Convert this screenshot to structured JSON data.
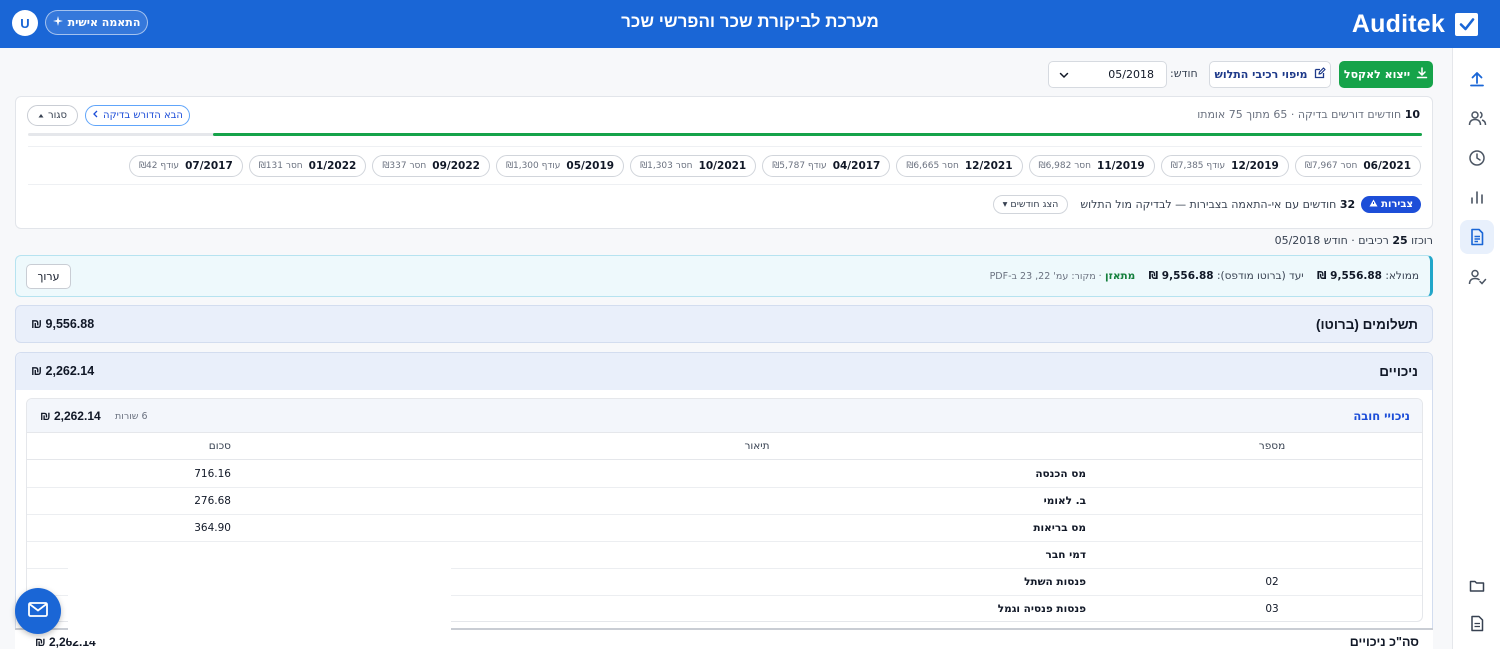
{
  "header": {
    "brand": "Auditek",
    "title": "מערכת לביקורת שכר והפרשי שכר",
    "personal_button": "התאמה אישית",
    "avatar_initial": "U"
  },
  "toolbar": {
    "export_label": "ייצוא לאקסל",
    "map_label": "מיפוי רכיבי התלוש",
    "month_label": "חודש:",
    "month_value": "05/2018"
  },
  "review": {
    "summary_count": "10",
    "summary_text": "חודשים דורשים בדיקה · 65 מתוך 75 אומתו",
    "progress_fraction": 0.867,
    "next_button": "הבא הדורש בדיקה",
    "close_button": "סגור",
    "chips": [
      {
        "month": "06/2021",
        "note": "חסר ₪7,967"
      },
      {
        "month": "12/2019",
        "note": "עודף ₪7,385"
      },
      {
        "month": "11/2019",
        "note": "חסר ₪6,982"
      },
      {
        "month": "12/2021",
        "note": "חסר ₪6,665"
      },
      {
        "month": "04/2017",
        "note": "עודף ₪5,787"
      },
      {
        "month": "10/2021",
        "note": "חסר ₪1,303"
      },
      {
        "month": "05/2019",
        "note": "עודף ₪1,300"
      },
      {
        "month": "09/2022",
        "note": "חסר ₪337"
      },
      {
        "month": "01/2022",
        "note": "חסר ₪131"
      },
      {
        "month": "07/2017",
        "note": "עודף ₪42"
      }
    ],
    "accumulation_badge": "צבירות",
    "accumulation_count": "32",
    "accumulation_text": "חודשים עם אי-התאמה בצבירות — לבדיקה מול התלוש",
    "show_months_button": "הצג חודשים"
  },
  "vehicle_line": {
    "prefix": "רוכזו",
    "count": "25",
    "suffix": "רכיבים · חודש 05/2018"
  },
  "filled": {
    "filled_label": "ממולא:",
    "filled_value": "9,556.88 ₪",
    "target_label": "יעד (ברוטו מודפס):",
    "target_value": "9,556.88 ₪",
    "status": "מתאזן",
    "source": "· מקור: עמ' 22, 23 ב-PDF",
    "edit_button": "ערוך"
  },
  "payments": {
    "title": "תשלומים (ברוטו)",
    "total": "9,556.88 ₪"
  },
  "deductions": {
    "title": "ניכויים",
    "total": "2,262.14 ₪",
    "sub": {
      "title": "ניכויי חובה",
      "total": "2,262.14 ₪",
      "count": "6 שורות",
      "columns": {
        "number": "מספר",
        "description": "תיאור",
        "amount": "סכום"
      },
      "rows": [
        {
          "number": "",
          "description": "מס הכנסה",
          "amount": "716.16"
        },
        {
          "number": "",
          "description": "ב. לאומי",
          "amount": "276.68"
        },
        {
          "number": "",
          "description": "מס בריאות",
          "amount": "364.90"
        },
        {
          "number": "",
          "description": "דמי חבר",
          "amount": ""
        },
        {
          "number": "02",
          "description": "פנסות השתל",
          "amount": ""
        },
        {
          "number": "03",
          "description": "פנסות פנסיה וגמל",
          "amount": ""
        }
      ]
    },
    "grand_total_label": "סה\"כ ניכויים",
    "grand_total_value": "2,262.14 ₪"
  },
  "colors": {
    "header": "#1a66d6",
    "export": "#16a34a",
    "accent_blue": "#1d4ed8",
    "progress": "#16a34a"
  },
  "icons": [
    "check-logo-icon",
    "sparkle-icon",
    "download-icon",
    "edit-icon",
    "chevron-down-icon",
    "chevron-left-icon",
    "caret-up-icon",
    "warning-icon",
    "caret-down-icon",
    "upload-icon",
    "users-icon",
    "clock-icon",
    "bar-chart-icon",
    "document-icon",
    "user-check-icon",
    "folder-icon",
    "file-icon",
    "mail-icon"
  ]
}
